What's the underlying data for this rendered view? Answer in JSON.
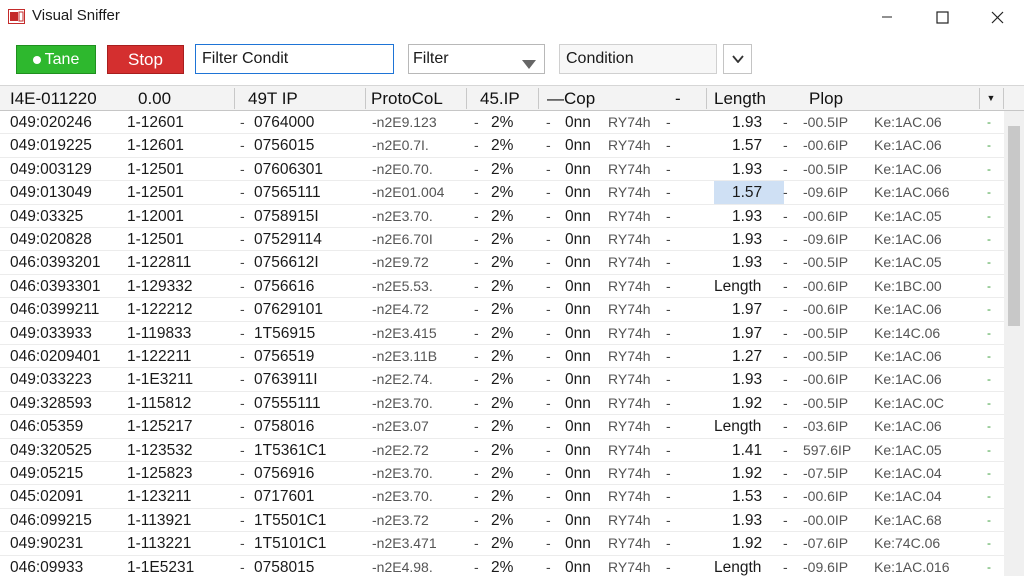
{
  "window": {
    "title": "Visual Sniffer"
  },
  "toolbar": {
    "start_label": "Tane",
    "stop_label": "Stop",
    "filter_value": "Filter Condit",
    "filter_select": "Filter",
    "condition_placeholder": "Condition"
  },
  "columns": [
    "I4E-011220",
    "0.00",
    "49T IP",
    "ProtoCoL",
    "45.IP",
    "—Cop",
    "-",
    "Length",
    "Plop"
  ],
  "colors": {
    "start": "#2eb82e",
    "stop": "#d42f2f",
    "focus": "#1e74d6",
    "selection": "#cfe0f4"
  },
  "rows": [
    {
      "no": "049:020246",
      "time": "1-12601",
      "p1": "-",
      "src": "0764000",
      "proto": "-n2E9.123",
      "d": "-",
      "ip": "2%",
      "s": "-",
      "cop": "0nn",
      "hex": "RY74h",
      "d2": "-",
      "len": "1.93",
      "d3": "-",
      "a": "-00.5IP",
      "b": "Ke:1AC.06",
      "t": "-",
      "hi": false
    },
    {
      "no": "049:019225",
      "time": "1-12601",
      "p1": "-",
      "src": "0756015",
      "proto": "-n2E0.7I.",
      "d": "-",
      "ip": "2%",
      "s": "-",
      "cop": "0nn",
      "hex": "RY74h",
      "d2": "-",
      "len": "1.57",
      "d3": "-",
      "a": "-00.6IP",
      "b": "Ke:1AC.06",
      "t": "-",
      "hi": false
    },
    {
      "no": "049:003129",
      "time": "1-12501",
      "p1": "-",
      "src": "07606301",
      "proto": "-n2E0.70.",
      "d": "-",
      "ip": "2%",
      "s": "-",
      "cop": "0nn",
      "hex": "RY74h",
      "d2": "-",
      "len": "1.93",
      "d3": "-",
      "a": "-00.5IP",
      "b": "Ke:1AC.06",
      "t": "-",
      "hi": false
    },
    {
      "no": "049:013049",
      "time": "1-12501",
      "p1": "-",
      "src": "07565111",
      "proto": "-n2E01.004",
      "d": "-",
      "ip": "2%",
      "s": "-",
      "cop": "0nn",
      "hex": "RY74h",
      "d2": "-",
      "len": "1.57",
      "d3": "-",
      "a": "-09.6IP",
      "b": "Ke:1AC.066",
      "t": "-",
      "hi": true
    },
    {
      "no": "049:03325",
      "time": "1-12001",
      "p1": "-",
      "src": "0758915I",
      "proto": "-n2E3.70.",
      "d": "-",
      "ip": "2%",
      "s": "-",
      "cop": "0nn",
      "hex": "RY74h",
      "d2": "-",
      "len": "1.93",
      "d3": "-",
      "a": "-00.6IP",
      "b": "Ke:1AC.05",
      "t": "-",
      "hi": false
    },
    {
      "no": "049:020828",
      "time": "1-12501",
      "p1": "-",
      "src": "07529114",
      "proto": "-n2E6.70I",
      "d": "-",
      "ip": "2%",
      "s": "-",
      "cop": "0nn",
      "hex": "RY74h",
      "d2": "-",
      "len": "1.93",
      "d3": "-",
      "a": "-09.6IP",
      "b": "Ke:1AC.06",
      "t": "-",
      "hi": false
    },
    {
      "no": "046:0393201",
      "time": "1-122811",
      "p1": "-",
      "src": "0756612I",
      "proto": "-n2E9.72",
      "d": "-",
      "ip": "2%",
      "s": "-",
      "cop": "0nn",
      "hex": "RY74h",
      "d2": "-",
      "len": "1.93",
      "d3": "-",
      "a": "-00.5IP",
      "b": "Ke:1AC.05",
      "t": "-",
      "hi": false
    },
    {
      "no": "046:0393301",
      "time": "1-129332",
      "p1": "-",
      "src": "0756616",
      "proto": "-n2E5.53.",
      "d": "-",
      "ip": "2%",
      "s": "-",
      "cop": "0nn",
      "hex": "RY74h",
      "d2": "-",
      "len": "Length",
      "d3": "-",
      "a": "-00.6IP",
      "b": "Ke:1BC.00",
      "t": "-",
      "hi": false
    },
    {
      "no": "046:0399211",
      "time": "1-122212",
      "p1": "-",
      "src": "07629101",
      "proto": "-n2E4.72",
      "d": "-",
      "ip": "2%",
      "s": "-",
      "cop": "0nn",
      "hex": "RY74h",
      "d2": "-",
      "len": "1.97",
      "d3": "-",
      "a": "-00.6IP",
      "b": "Ke:1AC.06",
      "t": "-",
      "hi": false
    },
    {
      "no": "049:033933",
      "time": "1-119833",
      "p1": "-",
      "src": "1T56915",
      "proto": "-n2E3.415",
      "d": "-",
      "ip": "2%",
      "s": "-",
      "cop": "0nn",
      "hex": "RY74h",
      "d2": "-",
      "len": "1.97",
      "d3": "-",
      "a": "-00.5IP",
      "b": "Ke:14C.06",
      "t": "-",
      "hi": false
    },
    {
      "no": "046:0209401",
      "time": "1-122211",
      "p1": "-",
      "src": "0756519",
      "proto": "-n2E3.11B",
      "d": "-",
      "ip": "2%",
      "s": "-",
      "cop": "0nn",
      "hex": "RY74h",
      "d2": "-",
      "len": "1.27",
      "d3": "-",
      "a": "-00.5IP",
      "b": "Ke:1AC.06",
      "t": "-",
      "hi": false
    },
    {
      "no": "049:033223",
      "time": "1-1E3211",
      "p1": "-",
      "src": "0763911I",
      "proto": "-n2E2.74.",
      "d": "-",
      "ip": "2%",
      "s": "-",
      "cop": "0nn",
      "hex": "RY74h",
      "d2": "-",
      "len": "1.93",
      "d3": "-",
      "a": "-00.6IP",
      "b": "Ke:1AC.06",
      "t": "-",
      "hi": false
    },
    {
      "no": "049:328593",
      "time": "1-115812",
      "p1": "-",
      "src": "07555111",
      "proto": "-n2E3.70.",
      "d": "-",
      "ip": "2%",
      "s": "-",
      "cop": "0nn",
      "hex": "RY74h",
      "d2": "-",
      "len": "1.92",
      "d3": "-",
      "a": "-00.5IP",
      "b": "Ke:1AC.0C",
      "t": "-",
      "hi": false
    },
    {
      "no": "046:05359",
      "time": "1-125217",
      "p1": "-",
      "src": "0758016",
      "proto": "-n2E3.07",
      "d": "-",
      "ip": "2%",
      "s": "-",
      "cop": "0nn",
      "hex": "RY74h",
      "d2": "-",
      "len": "Length",
      "d3": "-",
      "a": "-03.6IP",
      "b": "Ke:1AC.06",
      "t": "-",
      "hi": false
    },
    {
      "no": "049:320525",
      "time": "1-123532",
      "p1": "-",
      "src": "1T5361C1",
      "proto": "-n2E2.72",
      "d": "-",
      "ip": "2%",
      "s": "-",
      "cop": "0nn",
      "hex": "RY74h",
      "d2": "-",
      "len": "1.41",
      "d3": "-",
      "a": "597.6IP",
      "b": "Ke:1AC.05",
      "t": "-",
      "hi": false
    },
    {
      "no": "049:05215",
      "time": "1-125823",
      "p1": "-",
      "src": "0756916",
      "proto": "-n2E3.70.",
      "d": "-",
      "ip": "2%",
      "s": "-",
      "cop": "0nn",
      "hex": "RY74h",
      "d2": "-",
      "len": "1.92",
      "d3": "-",
      "a": "-07.5IP",
      "b": "Ke:1AC.04",
      "t": "-",
      "hi": false
    },
    {
      "no": "045:02091",
      "time": "1-123211",
      "p1": "-",
      "src": "0717601",
      "proto": "-n2E3.70.",
      "d": "-",
      "ip": "2%",
      "s": "-",
      "cop": "0nn",
      "hex": "RY74h",
      "d2": "-",
      "len": "1.53",
      "d3": "-",
      "a": "-00.6IP",
      "b": "Ke:1AC.04",
      "t": "-",
      "hi": false
    },
    {
      "no": "046:099215",
      "time": "1-113921",
      "p1": "-",
      "src": "1T5501C1",
      "proto": "-n2E3.72",
      "d": "-",
      "ip": "2%",
      "s": "-",
      "cop": "0nn",
      "hex": "RY74h",
      "d2": "-",
      "len": "1.93",
      "d3": "-",
      "a": "-00.0IP",
      "b": "Ke:1AC.68",
      "t": "-",
      "hi": false
    },
    {
      "no": "049:90231",
      "time": "1-113221",
      "p1": "-",
      "src": "1T5101C1",
      "proto": "-n2E3.471",
      "d": "-",
      "ip": "2%",
      "s": "-",
      "cop": "0nn",
      "hex": "RY74h",
      "d2": "-",
      "len": "1.92",
      "d3": "-",
      "a": "-07.6IP",
      "b": "Ke:74C.06",
      "t": "-",
      "hi": false
    },
    {
      "no": "046:09933",
      "time": "1-1E5231",
      "p1": "-",
      "src": "0758015",
      "proto": "-n2E4.98.",
      "d": "-",
      "ip": "2%",
      "s": "-",
      "cop": "0nn",
      "hex": "RY74h",
      "d2": "-",
      "len": "Length",
      "d3": "-",
      "a": "-09.6IP",
      "b": "Ke:1AC.016",
      "t": "-",
      "hi": false
    }
  ]
}
